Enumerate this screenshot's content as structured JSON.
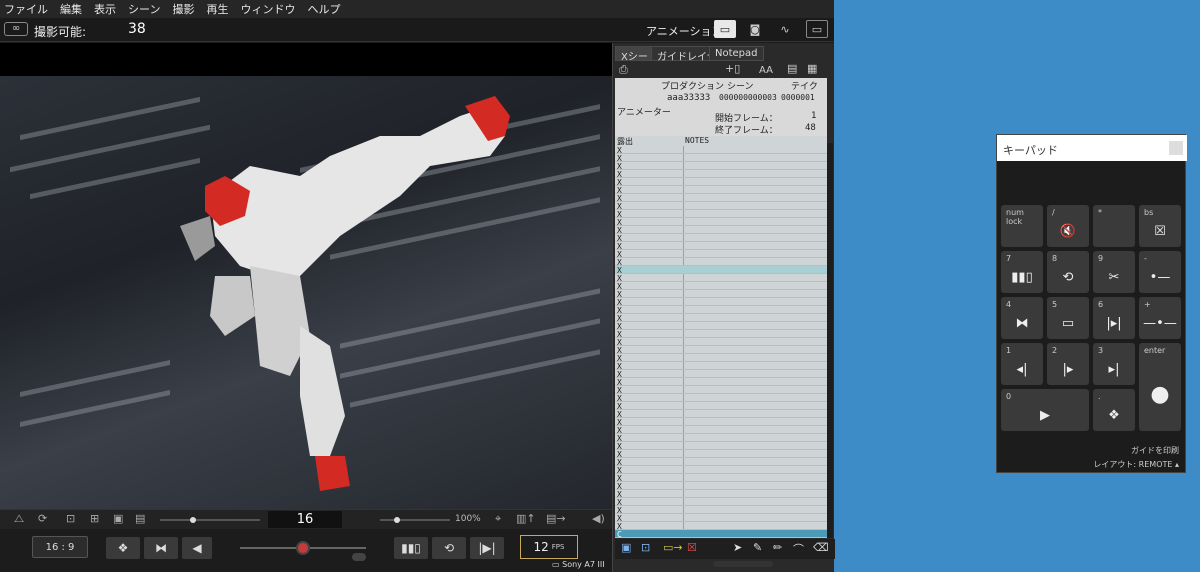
{
  "menu": [
    "ファイル",
    "編集",
    "表示",
    "シーン",
    "撮影",
    "再生",
    "ウィンドウ",
    "ヘルプ"
  ],
  "shot": {
    "label": "撮影可能:",
    "count": "38",
    "mode": "アニメーション"
  },
  "viewer": {
    "frame": "16",
    "zoom": "100%",
    "aspect": "16 : 9",
    "fps": "12",
    "fps_unit": "FPS",
    "camera": "Sony A7 III"
  },
  "xsheet": {
    "tabs": [
      "Xシート",
      "ガイドレイヤー",
      "Notepad"
    ],
    "aa": "AA",
    "header": {
      "production": "プロダクション",
      "scene": "シーン",
      "take": "テイク",
      "production_val": "aaa33333",
      "scene_val": "000000000003",
      "take_val": "0000001",
      "animator": "アニメーター",
      "start_label": "開始フレーム：",
      "start_val": "1",
      "end_label": "終了フレーム：",
      "end_val": "48"
    },
    "col_exposure": "露出",
    "col_notes": "NOTES",
    "rows": [
      "X",
      "X",
      "X",
      "X",
      "X",
      "X",
      "X",
      "X",
      "X",
      "X",
      "X",
      "X",
      "X",
      "X",
      "X",
      "X",
      "X",
      "X",
      "X",
      "X",
      "X",
      "X",
      "X",
      "X",
      "X",
      "X",
      "X",
      "X",
      "X",
      "X",
      "X",
      "X",
      "X",
      "X",
      "X",
      "X",
      "X",
      "X",
      "X",
      "X",
      "X",
      "X",
      "X",
      "X",
      "X",
      "X",
      "X",
      "X",
      "C"
    ],
    "highlight_index": 15,
    "current_index": 48
  },
  "keypad": {
    "title": "キーパッド",
    "keys": [
      {
        "n": "num\nlock",
        "g": ""
      },
      {
        "n": "/",
        "g": "🔇"
      },
      {
        "n": "*",
        "g": ""
      },
      {
        "n": "bs",
        "g": "☒"
      },
      {
        "n": "7",
        "g": "▮▮▯"
      },
      {
        "n": "8",
        "g": "⟲"
      },
      {
        "n": "9",
        "g": "✂"
      },
      {
        "n": "-",
        "g": "•—"
      },
      {
        "n": "4",
        "g": "⧓"
      },
      {
        "n": "5",
        "g": "▭"
      },
      {
        "n": "6",
        "g": "|▸|"
      },
      {
        "n": "+",
        "g": "—•—"
      },
      {
        "n": "1",
        "g": "◂|"
      },
      {
        "n": "2",
        "g": "|▸"
      },
      {
        "n": "3",
        "g": "▸|"
      },
      {
        "n": "enter",
        "g": "●"
      },
      {
        "n": "0",
        "g": "▶"
      },
      {
        "n": ".",
        "g": "❖"
      }
    ],
    "print": "ガイドを印刷",
    "layout": "レイアウト: REMOTE ▴"
  },
  "colors": {
    "accent": "#4a9ab8",
    "highlight": "#a8d0d4",
    "record": "#c43b3b",
    "desktop": "#3d8cc8"
  }
}
